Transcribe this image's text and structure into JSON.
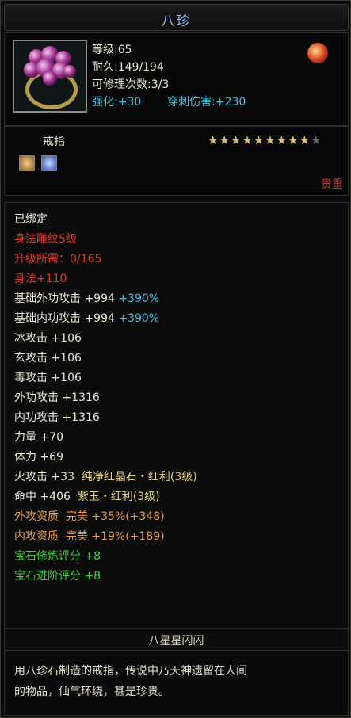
{
  "title": "八珍",
  "item": {
    "level": "等级:65",
    "durability": "耐久:149/194",
    "repair": "可修理次数:3/3",
    "enhance_label": "强化:",
    "enhance_value": "+30",
    "pierce_label": "穿刺伤害:",
    "pierce_value": "+230",
    "type": "戒指",
    "stars_on": "★★★★★★★★★",
    "stars_off": "★",
    "stars_filled": 9,
    "stars_total": 10,
    "rarity": "贵重"
  },
  "attrs": {
    "bound": "已绑定",
    "skill": "身法雕纹5级",
    "upgrade": "升级所需：0/165",
    "shenfa": "身法+110",
    "base_ext_label": "基础外功攻击 +994",
    "base_ext_pct": "+390%",
    "base_int_label": "基础内功攻击 +994",
    "base_int_pct": "+390%",
    "ice": "冰攻击 +106",
    "xuan": "玄攻击 +106",
    "poison": "毒攻击 +106",
    "ext_atk": "外功攻击 +1316",
    "int_atk": "内功攻击 +1316",
    "strength": "力量 +70",
    "stamina": "体力 +69",
    "fire": "火攻击 +33",
    "fire_gem": "纯净红晶石・红利(3级)",
    "hit": "命中 +406",
    "hit_gem": "紫玉・红利(3级)",
    "ext_apt": "外攻资质  完美 +35%(+348)",
    "int_apt": "内攻资质  完美 +19%(+189)",
    "gem_refine": "宝石修炼评分 +8",
    "gem_advance": "宝石进阶评分 +8"
  },
  "footer": {
    "title": "八星星闪闪",
    "desc_line1": "用八珍石制造的戒指，传说中乃天神遗留在人间",
    "desc_line2": "的物品，仙气环绕，甚是珍贵。"
  }
}
